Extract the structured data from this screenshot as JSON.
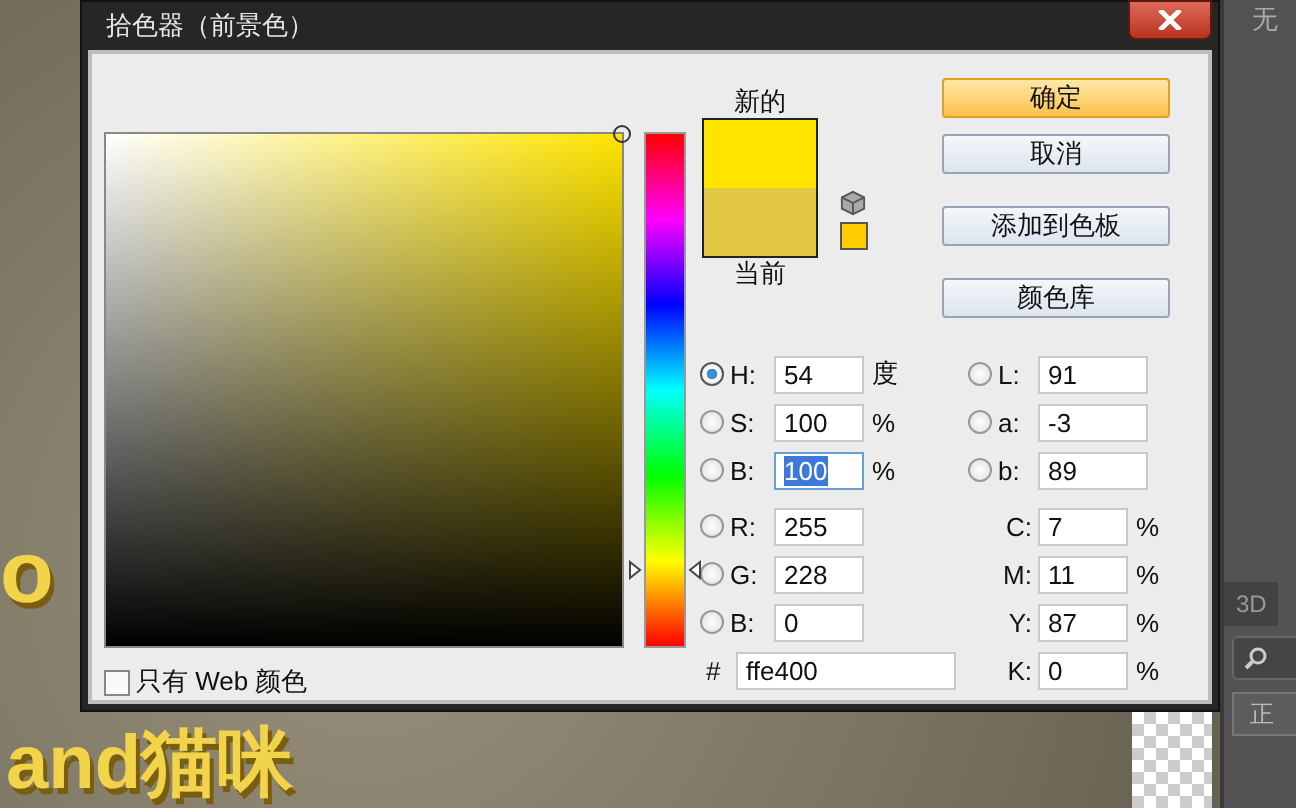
{
  "window": {
    "title": "拾色器（前景色）"
  },
  "hue_slider": {
    "level": 0.15
  },
  "swatches": [
    {
      "label": "新的",
      "color": "#ffe400"
    },
    {
      "label": "当前",
      "color": "#e3c843"
    }
  ],
  "buttons": [
    {
      "label": "确定",
      "default": true
    },
    {
      "label": "取消",
      "default": false
    },
    {
      "label": "添加到色板",
      "default": false
    },
    {
      "label": "颜色库",
      "default": false
    }
  ],
  "hsb_fields": [
    {
      "label": "H:",
      "value": "54",
      "unit": "度",
      "selected": true,
      "focused": false
    },
    {
      "label": "S:",
      "value": "100",
      "unit": "%",
      "selected": false,
      "focused": false
    },
    {
      "label": "B:",
      "value": "100",
      "unit": "%",
      "selected": false,
      "focused": true
    }
  ],
  "rgb_fields": [
    {
      "label": "R:",
      "value": "255",
      "selected": false,
      "focused": false
    },
    {
      "label": "G:",
      "value": "228",
      "selected": false,
      "focused": false
    },
    {
      "label": "B:",
      "value": "0",
      "selected": false,
      "focused": false
    }
  ],
  "hex": {
    "label": "#",
    "value": "ffe400"
  },
  "lab_fields": [
    {
      "label": "L:",
      "value": "91",
      "selected": false,
      "focused": false
    },
    {
      "label": "a:",
      "value": "-3",
      "selected": false,
      "focused": false
    },
    {
      "label": "b:",
      "value": "89",
      "selected": false,
      "focused": false
    }
  ],
  "cmyk_fields": [
    {
      "label": "C:",
      "value": "7",
      "unit": "%",
      "focused": false
    },
    {
      "label": "M:",
      "value": "11",
      "unit": "%",
      "focused": false
    },
    {
      "label": "Y:",
      "value": "87",
      "unit": "%",
      "focused": false
    },
    {
      "label": "K:",
      "value": "0",
      "unit": "%",
      "focused": false
    }
  ],
  "web_colors_only": {
    "label": "只有 Web 颜色",
    "checked": false
  },
  "canvas": {
    "texts": [
      "o",
      "and猫咪"
    ]
  },
  "panel": {
    "title": "无",
    "tab": "3D",
    "blend_mode": "正"
  }
}
